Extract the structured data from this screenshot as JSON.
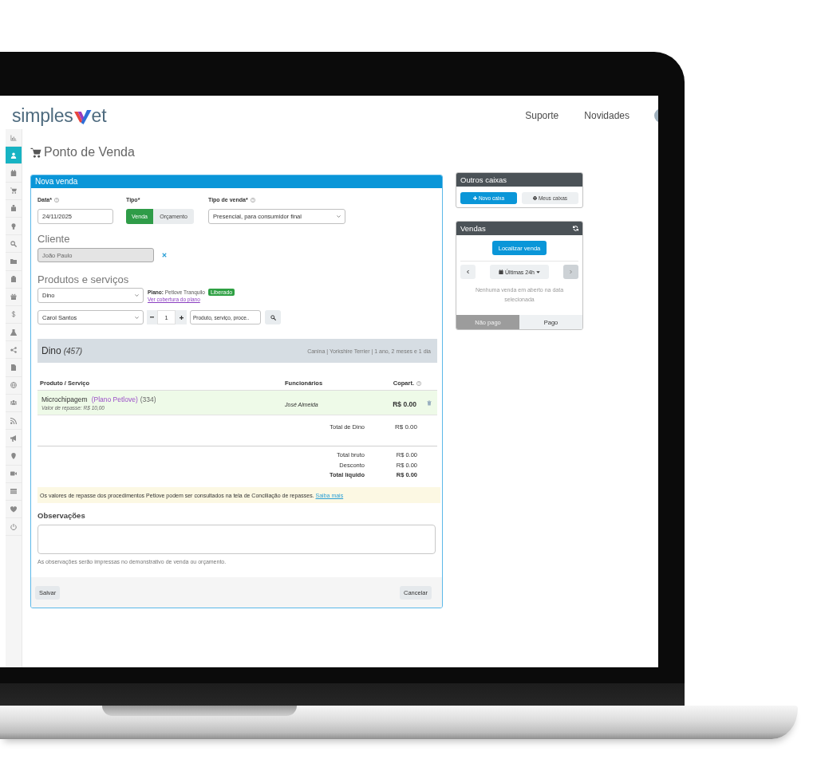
{
  "header": {
    "logo": {
      "text_start": "simples",
      "text_end": "et"
    },
    "nav": [
      "Suporte",
      "Novidades"
    ]
  },
  "sidebar": {
    "items": [
      {
        "kind": "chart",
        "selected": false
      },
      {
        "kind": "user",
        "selected": true
      },
      {
        "kind": "calendar",
        "selected": false
      },
      {
        "kind": "cart",
        "selected": false
      },
      {
        "kind": "building",
        "selected": false
      },
      {
        "kind": "lightbulb",
        "selected": false
      },
      {
        "kind": "search",
        "selected": false
      },
      {
        "kind": "folder",
        "selected": false
      },
      {
        "kind": "clipboard",
        "selected": false
      },
      {
        "kind": "gift",
        "selected": false
      },
      {
        "kind": "dollar",
        "selected": false
      },
      {
        "kind": "flask",
        "selected": false
      },
      {
        "kind": "nodes",
        "selected": false
      },
      {
        "kind": "document",
        "selected": false
      },
      {
        "kind": "globe",
        "selected": false
      },
      {
        "kind": "users",
        "selected": false
      },
      {
        "kind": "rss",
        "selected": false
      },
      {
        "kind": "megaphone",
        "selected": false
      },
      {
        "kind": "map-marker",
        "selected": false
      },
      {
        "kind": "video-camera",
        "selected": false
      },
      {
        "kind": "list",
        "selected": false
      },
      {
        "kind": "heart",
        "selected": false
      },
      {
        "kind": "power",
        "selected": false
      }
    ]
  },
  "page_title": "Ponto de Venda",
  "sale_panel": {
    "title": "Nova venda",
    "date": {
      "label": "Data*",
      "help": true,
      "value": "24/11/2025"
    },
    "type": {
      "label": "Tipo*",
      "help": false,
      "options": [
        {
          "label": "Venda",
          "selected": true
        },
        {
          "label": "Orçamento",
          "selected": false
        }
      ]
    },
    "sale_type": {
      "label": "Tipo de venda*",
      "help": true,
      "value": "Presencial, para consumidor final"
    },
    "client": {
      "heading": "Cliente",
      "value": "João Paulo",
      "disabled": true
    },
    "products": {
      "heading": "Produtos e serviços",
      "pet": "Dino",
      "plan": "**Plano:** Petlove Tranquilo",
      "plan_status": "Liberado",
      "coverage_link": "Ver cobertura do plano",
      "staff": "Carol Santos",
      "quantity": "1",
      "search": {
        "placeholder": "Produto, serviço, proce.."
      }
    },
    "pet_band": {
      "name": "Dino",
      "code": "(457)",
      "details": "Canina | Yorkshire Terrier | 1 ano, 2 meses e 1 dia"
    },
    "table": {
      "columns": [
        {
          "label": "Produto / Serviço",
          "help": false
        },
        {
          "label": "Funcionários",
          "help": false
        },
        {
          "label": "Copart.",
          "help": true
        }
      ],
      "rows": [
        {
          "product": "Microchipagem",
          "plan": "(Plano Petlove)",
          "code": "(334)",
          "note": "Valor de repasse: R$ 10,00",
          "staff": "José Almeida",
          "copay": "R$ 0.00"
        }
      ]
    },
    "pet_total": {
      "label": "Total de Dino",
      "value": "R$ 0.00"
    },
    "totals": [
      {
        "label": "Total bruto",
        "value": "R$ 0.00",
        "bold": false
      },
      {
        "label": "Desconto",
        "value": "R$ 0.00",
        "bold": false
      },
      {
        "label": "Total líquido",
        "value": "R$ 0.00",
        "bold": true
      }
    ],
    "alert": {
      "text": "Os valores de repasse dos procedimentos Petlove podem ser consultados na tela de Conciliação de repasses.",
      "link": "Saiba mais"
    },
    "notes": {
      "label": "Observações",
      "help": "As observações serão impressas no demonstrativo de venda ou orçamento."
    },
    "actions": [
      "Salvar",
      "Cancelar"
    ]
  },
  "cash_panel": {
    "title": "Outros caixas",
    "buttons": [
      {
        "label": "Novo caixa",
        "kind": "primary"
      },
      {
        "label": "Meus caixas",
        "kind": "default"
      }
    ]
  },
  "sales_panel": {
    "title": "Vendas",
    "find_button": "Localizar venda",
    "period": "Últimas 24h",
    "prev": {
      "disabled": false
    },
    "next": {
      "disabled": true
    },
    "empty_message": "Nenhuma venda em aberto na data selecionada",
    "tabs": [
      {
        "label": "Não pago",
        "selected": true
      },
      {
        "label": "Pago",
        "selected": false
      }
    ]
  }
}
